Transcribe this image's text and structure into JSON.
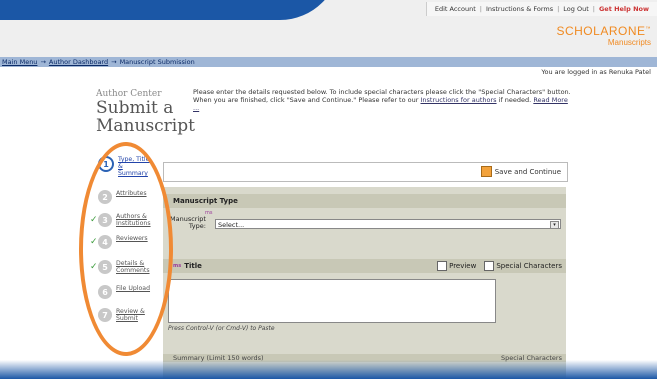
{
  "top_links": [
    "Edit Account",
    "Instructions & Forms",
    "Log Out",
    "Get Help Now"
  ],
  "brand": {
    "name": "SCHOLARONE",
    "tm": "™",
    "product": "Manuscripts"
  },
  "breadcrumb": {
    "items": [
      "Main Menu",
      "Author Dashboard",
      "Manuscript Submission"
    ],
    "separator": "→"
  },
  "logged_in": "You are logged in as Renuka Patel",
  "header": {
    "kicker": "Author Center",
    "title_line1": "Submit a",
    "title_line2": "Manuscript"
  },
  "intro": {
    "text": "Please enter the details requested below. To include special characters please click the \"Special Characters\" button. When you are finished, click \"Save and Continue.\" Please refer to our",
    "link1": "Instructions for authors",
    "text2": "if needed.",
    "link2": "Read More ..."
  },
  "steps": [
    {
      "num": "1",
      "label_lines": [
        "Type, Title,",
        "&",
        "Summary"
      ],
      "active": true,
      "done": false
    },
    {
      "num": "2",
      "label_lines": [
        "Attributes"
      ],
      "active": false,
      "done": false
    },
    {
      "num": "3",
      "label_lines": [
        "Authors &",
        "Institutions"
      ],
      "active": false,
      "done": true
    },
    {
      "num": "4",
      "label_lines": [
        "Reviewers"
      ],
      "active": false,
      "done": true
    },
    {
      "num": "5",
      "label_lines": [
        "Details &",
        "Comments"
      ],
      "active": false,
      "done": true
    },
    {
      "num": "6",
      "label_lines": [
        "File Upload"
      ],
      "active": false,
      "done": false
    },
    {
      "num": "7",
      "label_lines": [
        "Review &",
        "Submit"
      ],
      "active": false,
      "done": false
    }
  ],
  "save_button": "Save and Continue",
  "manuscript_type": {
    "heading": "Manuscript Type",
    "label_line1": "Manuscript",
    "label_line2": "Type:",
    "req": "ms",
    "selected": "Select..."
  },
  "title_section": {
    "heading": "Title",
    "req": "ms",
    "preview": "Preview",
    "special_chars": "Special Characters",
    "hint": "Press Control-V (or Cmd-V) to Paste"
  },
  "summary_section": {
    "heading": "Summary   (Limit 150 words)",
    "right": "Special Characters"
  },
  "colors": {
    "accent_orange": "#f08a34",
    "brand_blue": "#1b57a6",
    "panel": "#d9d9cc"
  }
}
